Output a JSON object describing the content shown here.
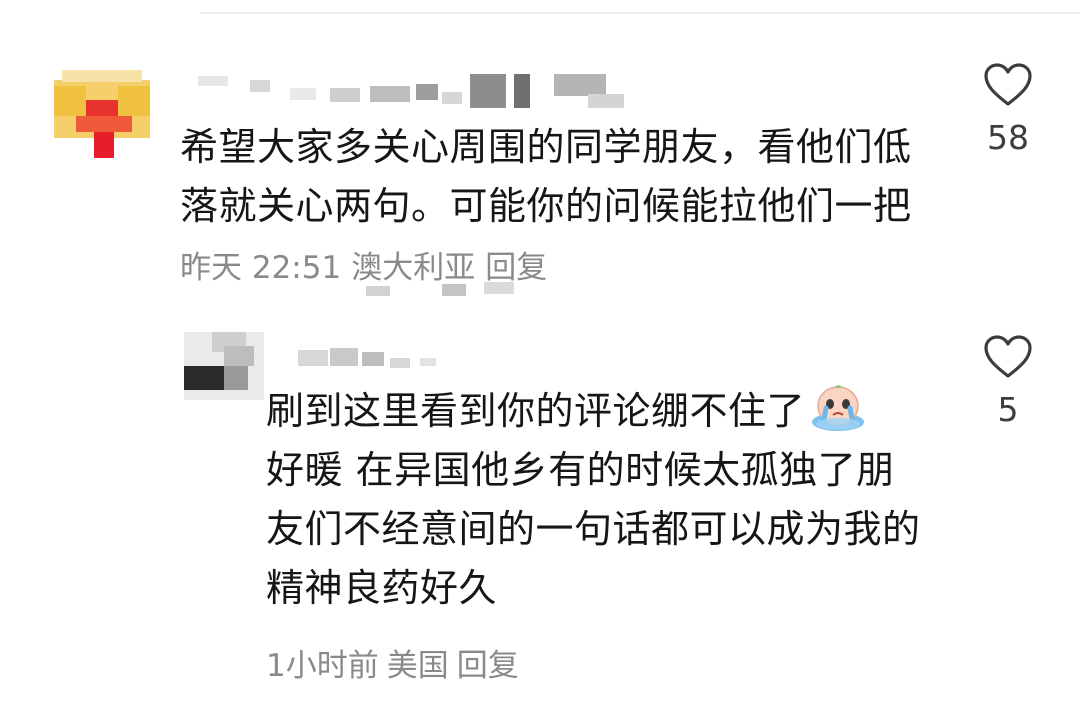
{
  "comments": {
    "main": {
      "text": "希望大家多关心周围的同学朋友，看他们低落就关心两句。可能你的问候能拉他们一把",
      "time": "昨天 22:51",
      "location": "澳大利亚",
      "reply_label": "回复",
      "like_count": "58",
      "colors": {
        "avatar_primary": "#f2c24a",
        "avatar_accent": "#e8322d"
      }
    },
    "reply": {
      "text_line1": "刷到这里看到你的评论绷不住了",
      "text_rest": "好暖 在异国他乡有的时候太孤独了朋友们不经意间的一句话都可以成为我的精神良药好久",
      "emoji": "crying-face-sticker",
      "time": "1小时前",
      "location": "美国",
      "reply_label": "回复",
      "like_count": "5"
    }
  }
}
